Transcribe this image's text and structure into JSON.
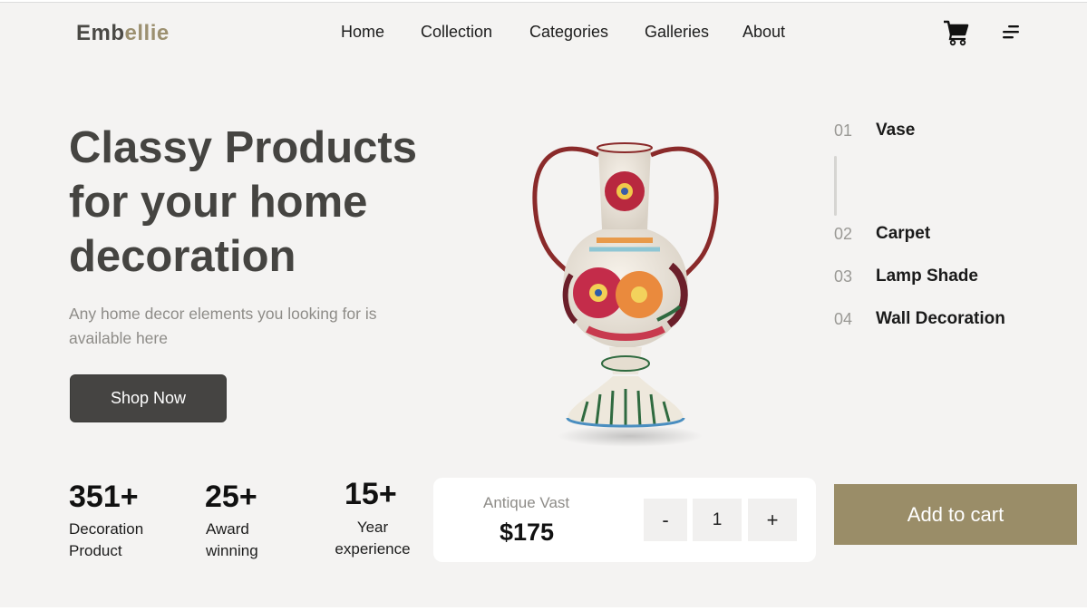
{
  "brand": {
    "logo_part1": "Emb",
    "logo_part2": "ellie"
  },
  "nav": {
    "items": [
      {
        "label": "Home"
      },
      {
        "label": "Collection"
      },
      {
        "label": "Categories"
      },
      {
        "label": "Galleries"
      },
      {
        "label": "About"
      }
    ]
  },
  "header_icons": [
    "cart-icon",
    "menu-icon"
  ],
  "hero": {
    "title": "Classy Products for your home decoration",
    "subtitle": "Any home decor elements you looking for is available here",
    "cta_label": "Shop Now"
  },
  "categories": [
    {
      "num": "01",
      "label": "Vase"
    },
    {
      "num": "02",
      "label": "Carpet"
    },
    {
      "num": "03",
      "label": "Lamp Shade"
    },
    {
      "num": "04",
      "label": "Wall Decoration"
    }
  ],
  "stats": [
    {
      "value": "351+",
      "label_line1": "Decoration",
      "label_line2": "Product"
    },
    {
      "value": "25+",
      "label_line1": "Award",
      "label_line2": "winning"
    },
    {
      "value": "15+",
      "label_line1": "Year",
      "label_line2": "experience"
    }
  ],
  "product": {
    "name": "Antique Vast",
    "price": "$175",
    "qty_minus": "-",
    "qty_value": "1",
    "qty_plus": "+",
    "add_to_cart_label": "Add to cart"
  },
  "colors": {
    "background": "#f4f3f2",
    "logo_dark": "#4a4945",
    "logo_accent": "#9c9070",
    "button_dark": "#454442",
    "accent_gold": "#9a8d68"
  }
}
